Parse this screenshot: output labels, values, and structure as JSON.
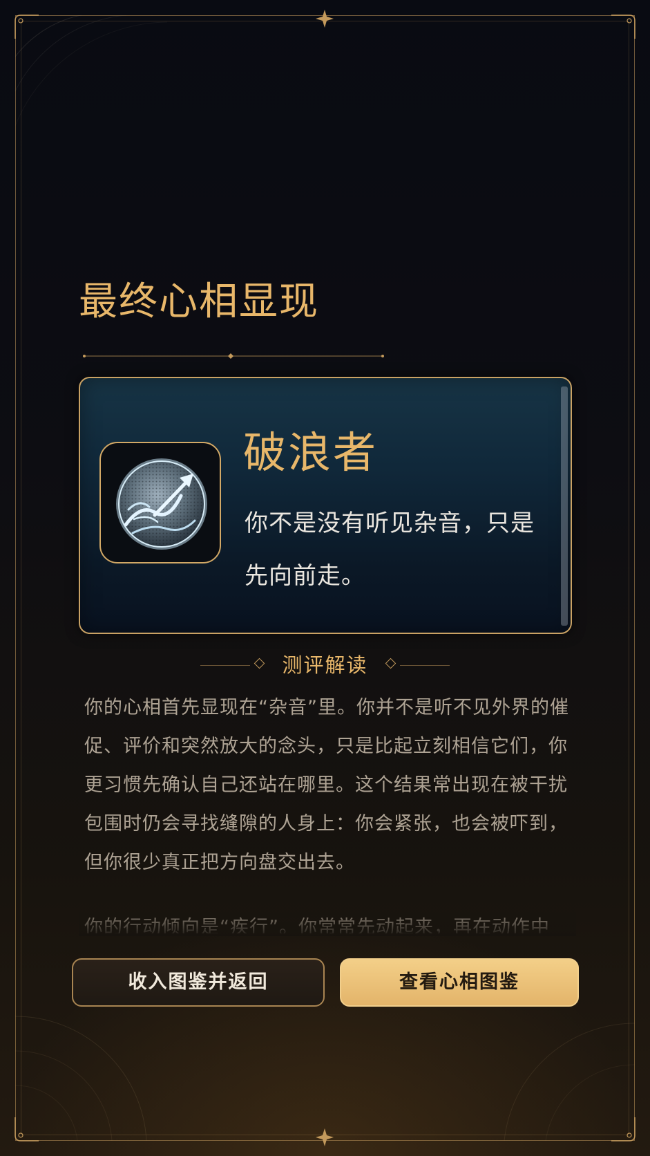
{
  "page": {
    "title": "最终心相显现"
  },
  "result_card": {
    "name": "破浪者",
    "tagline": "你不是没有听见杂音，只是先向前走。",
    "emblem_icon": "wave-arrow-emblem-icon"
  },
  "reading": {
    "heading": "测评解读",
    "paragraphs": [
      "你的心相首先显现在“杂音”里。你并不是听不见外界的催促、评价和突然放大的念头，只是比起立刻相信它们，你更习惯先确认自己还站在哪里。这个结果常出现在被干扰包围时仍会寻找缝隙的人身上：你会紧张，也会被吓到，但你很少真正把方向盘交出去。",
      "你的行动倾向是“疾行”。你常常先动起来，再在动作中"
    ]
  },
  "buttons": {
    "secondary_label": "收入图鉴并返回",
    "primary_label": "查看心相图鉴"
  },
  "colors": {
    "accent_gold": "#e8b76a",
    "frame_gold": "#c49a5c",
    "card_teal": "#10283a",
    "background": "#0b0c12"
  }
}
